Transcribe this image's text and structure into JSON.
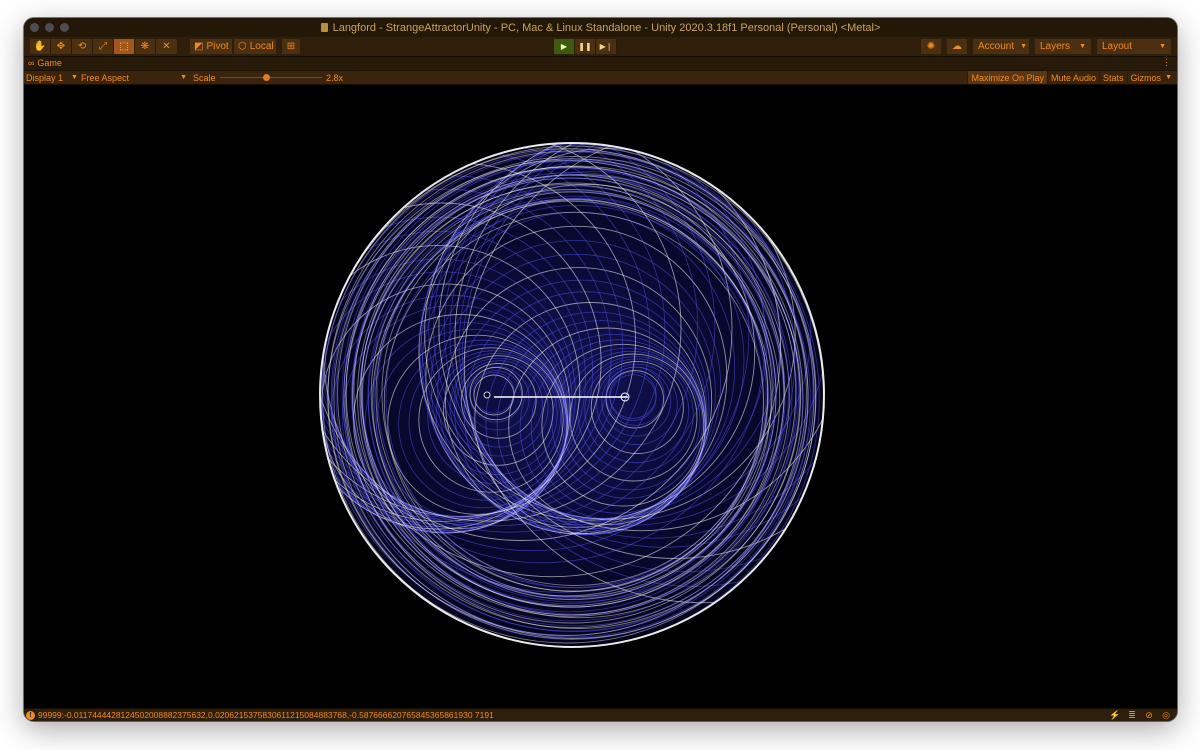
{
  "window": {
    "title": "Langford - StrangeAttractorUnity - PC, Mac & Linux Standalone - Unity 2020.3.18f1 Personal (Personal) <Metal>"
  },
  "toolbar": {
    "tools": [
      {
        "name": "hand-tool-button",
        "glyph": "✋",
        "active": false
      },
      {
        "name": "move-tool-button",
        "glyph": "✥",
        "active": false
      },
      {
        "name": "rotate-tool-button",
        "glyph": "⟲",
        "active": false
      },
      {
        "name": "scale-tool-button",
        "glyph": "⤢",
        "active": false
      },
      {
        "name": "rect-tool-button",
        "glyph": "⬚",
        "active": true
      },
      {
        "name": "transform-tool-button",
        "glyph": "❋",
        "active": false
      },
      {
        "name": "custom-tool-button",
        "glyph": "✕",
        "active": false
      }
    ],
    "pivot_label": "Pivot",
    "local_label": "Local",
    "account_label": "Account",
    "layers_label": "Layers",
    "layout_label": "Layout"
  },
  "game_tab": {
    "label": "Game"
  },
  "game_toolbar": {
    "display_label": "Display 1",
    "aspect_label": "Free Aspect",
    "scale_label": "Scale",
    "scale_value": "2.8x",
    "scale_fraction": 0.45,
    "maximize_label": "Maximize On Play",
    "mute_label": "Mute Audio",
    "stats_label": "Stats",
    "gizmos_label": "Gizmos"
  },
  "status": {
    "message": "99999:-0.0117444428124502008882375632,0.0206215375830611215084883768,-0.587666620765845365861930 7191"
  },
  "colors": {
    "accent": "#f08a26",
    "attractor_blue": "#5c5cff",
    "attractor_white": "#ffffff"
  }
}
